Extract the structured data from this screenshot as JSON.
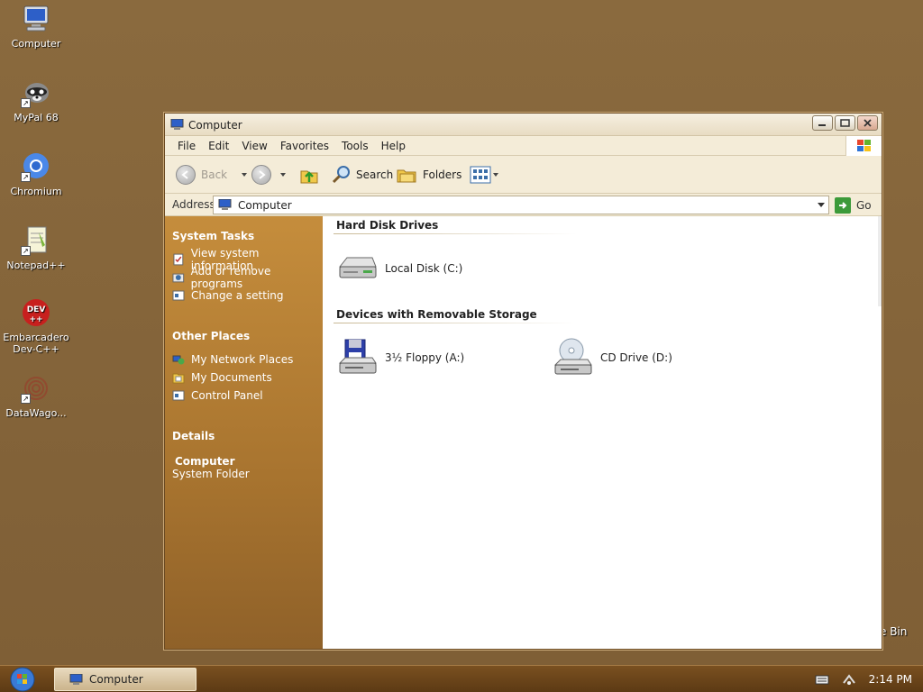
{
  "desktop": {
    "icons": [
      {
        "label": "Computer"
      },
      {
        "label": "MyPal 68"
      },
      {
        "label": "Chromium"
      },
      {
        "label": "Notepad++"
      },
      {
        "label_line1": "Embarcadero",
        "label_line2": "Dev-C++",
        "dev_text": "DEV"
      },
      {
        "label": "DataWago..."
      }
    ],
    "recycle_bin_partial": "e Bin"
  },
  "window": {
    "title": "Computer",
    "menu": [
      "File",
      "Edit",
      "View",
      "Favorites",
      "Tools",
      "Help"
    ],
    "toolbar": {
      "back": "Back",
      "search": "Search",
      "folders": "Folders"
    },
    "address": {
      "label": "Address",
      "value": "Computer",
      "go": "Go"
    },
    "left_pane": {
      "system_tasks": {
        "title": "System Tasks",
        "items": [
          "View system information",
          "Add or remove programs",
          "Change a setting"
        ]
      },
      "other_places": {
        "title": "Other Places",
        "items": [
          "My Network Places",
          "My Documents",
          "Control Panel"
        ]
      },
      "details": {
        "title": "Details",
        "name": "Computer",
        "sub": "System Folder"
      }
    },
    "content": {
      "hard_disk_drives": {
        "title": "Hard Disk Drives",
        "drives": [
          "Local Disk (C:)"
        ]
      },
      "removable": {
        "title": "Devices with Removable Storage",
        "drives": [
          "3½ Floppy (A:)",
          "CD Drive (D:)"
        ]
      }
    }
  },
  "taskbar": {
    "task_label": "Computer",
    "clock": "2:14 PM"
  },
  "colors": {
    "accent": "#c58d3c",
    "desktop": "#84643a",
    "taskbar": "#5c3a14"
  }
}
